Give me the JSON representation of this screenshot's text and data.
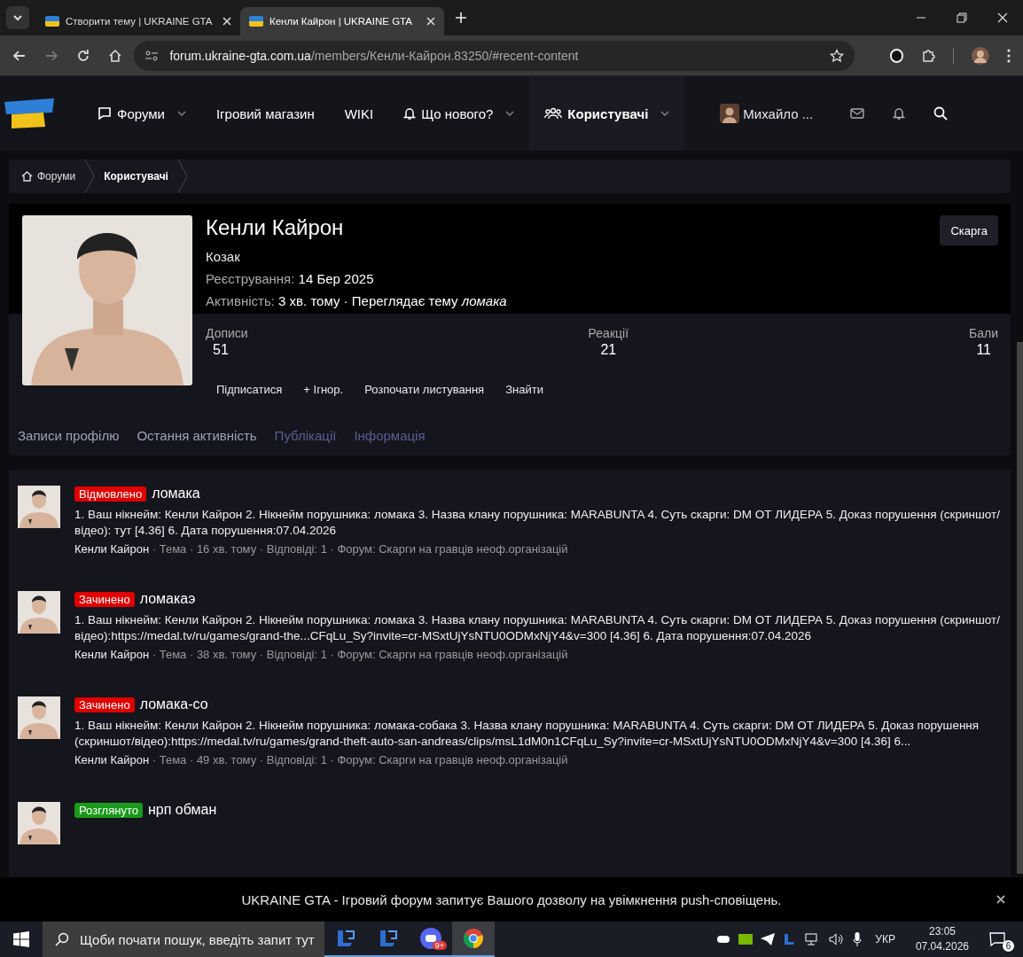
{
  "browser": {
    "tabs": [
      {
        "title": "Створити тему | UKRAINE GTA",
        "selected": false
      },
      {
        "title": "Кенли Кайрон | UKRAINE GTA",
        "selected": true
      }
    ],
    "url": {
      "host": "forum.ukraine-gta.com.ua",
      "path": "/members/Кенли-Кайрон.83250/#recent-content"
    }
  },
  "nav": [
    {
      "label": "Форуми",
      "kind": "chat",
      "caret": true,
      "bold": false
    },
    {
      "label": "Ігровий магазин",
      "kind": "plain",
      "caret": false,
      "bold": false
    },
    {
      "label": "WIKI",
      "kind": "plain",
      "caret": false,
      "bold": false
    },
    {
      "label": "Що нового?",
      "kind": "bell",
      "caret": true,
      "bold": false
    },
    {
      "label": "Користувачі",
      "kind": "users",
      "caret": true,
      "bold": true
    }
  ],
  "user": {
    "name": "Михайло ..."
  },
  "breadcrumbs": [
    {
      "label": "Форуми",
      "current": false
    },
    {
      "label": "Користувачі",
      "current": true
    }
  ],
  "profile": {
    "name": "Кенли Кайрон",
    "title": "Козак",
    "registered": {
      "label": "Реєстрування:",
      "value": "14 Бер 2025"
    },
    "activity": {
      "label": "Активність:",
      "value": "3 хв. тому · Переглядає тему",
      "topic": "ломака"
    },
    "report_button": "Скарга",
    "stats": [
      {
        "label": "Дописи",
        "value": "51"
      },
      {
        "label": "Реакції",
        "value": "21"
      },
      {
        "label": "Бали",
        "value": "11"
      }
    ],
    "actions": [
      "Підписатися",
      "+ Ігнор.",
      "Розпочати листування",
      "Знайти"
    ],
    "tabs": [
      {
        "label": "Записи профілю",
        "muted": false
      },
      {
        "label": "Остання активність",
        "muted": false
      },
      {
        "label": "Публікації",
        "muted": true
      },
      {
        "label": "Інформація",
        "muted": true
      }
    ]
  },
  "posts": [
    {
      "status": "Відмовлено",
      "color": "#e00000",
      "title": "ломака",
      "body": "1. Ваш нікнейм: Кенли Кайрон 2. Нікнейм порушника: ломака 3. Назва клану порушника: MARABUNTA 4. Суть скарги: DM ОТ ЛИДЕРА 5. Доказ порушення (скриншот/відео): тут [4.36] 6. Дата порушення:07.04.2026",
      "author": "Кенли Кайрон",
      "meta": "· Тема · 16 хв. тому · Відповіді: 1 · Форум: Скарги на гравців неоф.організацій"
    },
    {
      "status": "Зачинено",
      "color": "#e00000",
      "title": "ломакаэ",
      "body": "1. Ваш нікнейм: Кенли Кайрон 2. Нікнейм порушника: ломака 3. Назва клану порушника: MARABUNTA 4. Суть скарги: DM ОТ ЛИДЕРА 5. Доказ порушення (скриншот/відео):https://medal.tv/ru/games/grand-the...CFqLu_Sy?invite=cr-MSxtUjYsNTU0ODMxNjY4&v=300 [4.36] 6. Дата порушення:07.04.2026",
      "author": "Кенли Кайрон",
      "meta": "· Тема · 38 хв. тому · Відповіді: 1 · Форум: Скарги на гравців неоф.організацій"
    },
    {
      "status": "Зачинено",
      "color": "#e00000",
      "title": "ломака-со",
      "body": "1. Ваш нікнейм: Кенли Кайрон 2. Нікнейм порушника: ломака-собака 3. Назва клану порушника: MARABUNTA 4. Суть скарги: DM ОТ ЛИДЕРА 5. Доказ порушення (скриншот/відео):https://medal.tv/ru/games/grand-theft-auto-san-andreas/clips/msL1dM0n1CFqLu_Sy?invite=cr-MSxtUjYsNTU0ODMxNjY4&v=300 [4.36] 6...",
      "author": "Кенли Кайрон",
      "meta": "· Тема · 49 хв. тому · Відповіді: 1 · Форум: Скарги на гравців неоф.організацій"
    },
    {
      "status": "Розглянуто",
      "color": "#1a9a1a",
      "title": "нрп обман"
    }
  ],
  "push_notice": "UKRAINE GTA - Ігровий форум запитує Вашого дозволу на увімкнення push-сповіщень.",
  "taskbar": {
    "search_placeholder": "Щоби почати пошук, введіть запит тут",
    "discord_badge": "9+",
    "language": "УКР",
    "time": "23:05",
    "date": "07.04.2026",
    "notifications": "6"
  }
}
